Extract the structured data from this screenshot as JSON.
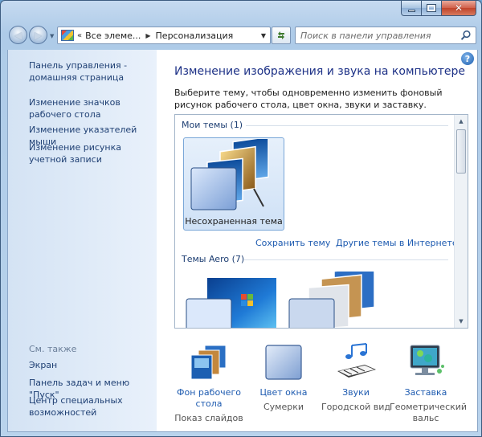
{
  "window": {
    "caption_buttons": {
      "minimize": "minimize-icon",
      "maximize": "maximize-icon",
      "close": "close-icon"
    }
  },
  "address_bar": {
    "prefix": "«",
    "crumbs": [
      "Все элеме...",
      "Персонализация"
    ],
    "refresh_icon": "refresh-icon"
  },
  "search": {
    "placeholder": "Поиск в панели управления"
  },
  "sidebar": {
    "home_link": "Панель управления - домашняя страница",
    "links": [
      "Изменение значков рабочего стола",
      "Изменение указателей мыши",
      "Изменение рисунка учетной записи"
    ],
    "see_also_label": "См. также",
    "see_also": [
      "Экран",
      "Панель задач и меню \"Пуск\"",
      "Центр специальных возможностей"
    ]
  },
  "main": {
    "title": "Изменение изображения и звука на компьютере",
    "description": "Выберите тему, чтобы одновременно изменить фоновый рисунок рабочего стола, цвет окна, звуки и заставку.",
    "my_themes_label": "Мои темы (1)",
    "unsaved_theme": "Несохраненная тема",
    "save_theme_link": "Сохранить тему",
    "more_themes_link": "Другие темы в Интернете",
    "aero_label": "Темы Aero (7)"
  },
  "bottom": [
    {
      "label": "Фон рабочего стола",
      "value": "Показ слайдов",
      "icon": "wallpaper-icon"
    },
    {
      "label": "Цвет окна",
      "value": "Сумерки",
      "icon": "window-color-icon"
    },
    {
      "label": "Звуки",
      "value": "Городской вид",
      "icon": "sounds-icon"
    },
    {
      "label": "Заставка",
      "value": "Геометрический вальс",
      "icon": "screensaver-icon"
    }
  ],
  "colors": {
    "link": "#1e5bb0",
    "title": "#1e3287",
    "sidebar_bg": "#dbe8f6",
    "frame": "#b9d3ec"
  }
}
